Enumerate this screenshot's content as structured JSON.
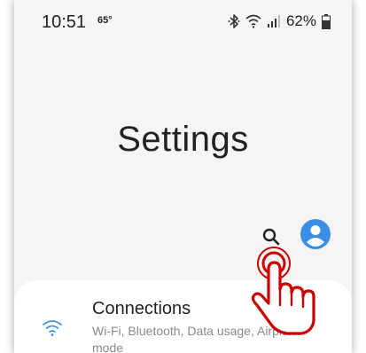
{
  "status_bar": {
    "time": "10:51",
    "temperature": "65°",
    "battery_percent": "62%",
    "icons": [
      "bluetooth-icon",
      "wifi-icon",
      "signal-icon",
      "battery-icon"
    ]
  },
  "header": {
    "title": "Settings"
  },
  "toolbar": {
    "search_icon": "search-icon",
    "profile_icon": "profile-icon"
  },
  "list": {
    "items": [
      {
        "title": "Connections",
        "subtitle": "Wi-Fi, Bluetooth, Data usage, Airplane mode",
        "icon": "wifi-icon"
      }
    ]
  },
  "colors": {
    "accent": "#3a8ee6",
    "pointer": "#cc0000",
    "background": "#f5f5f5"
  }
}
